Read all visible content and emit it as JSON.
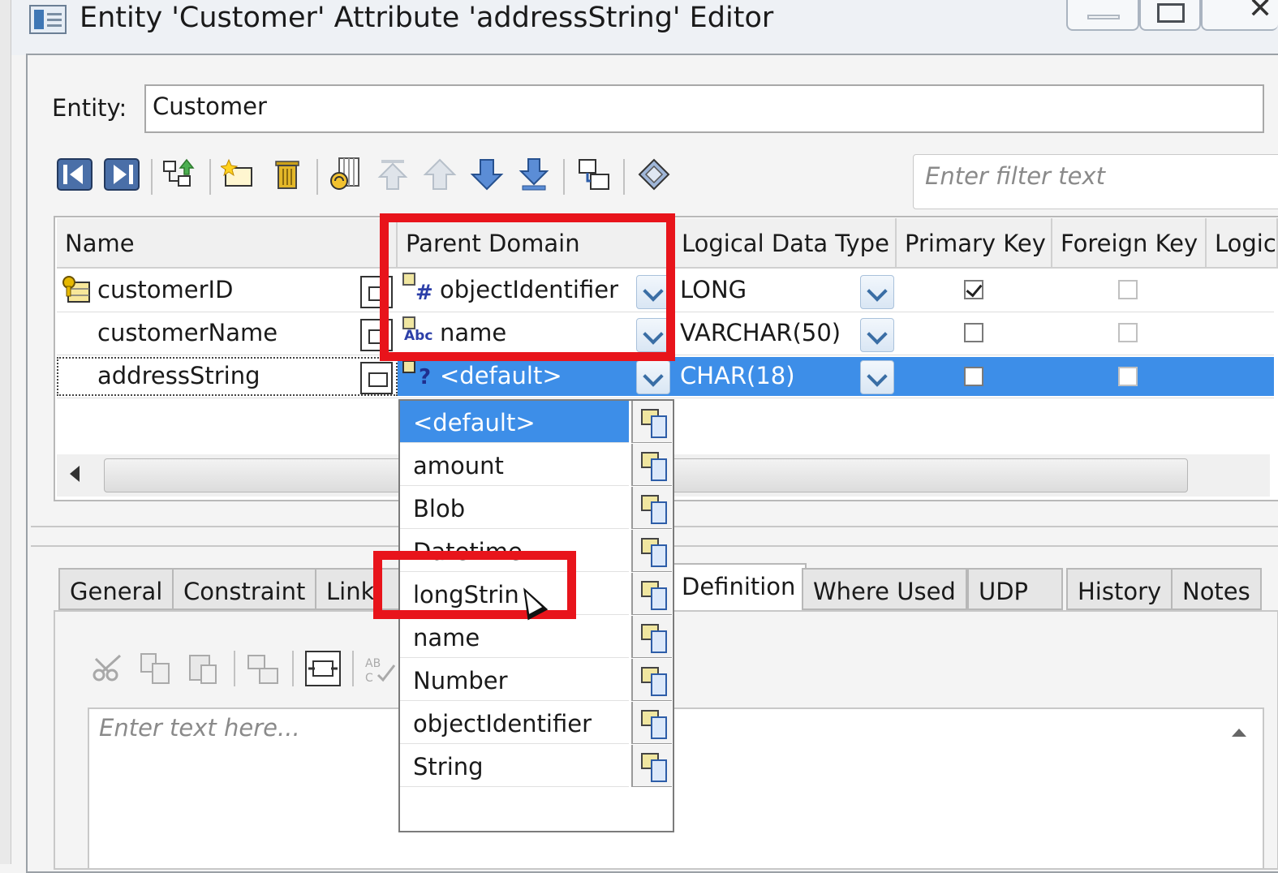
{
  "window": {
    "title": "Entity 'Customer' Attribute 'addressString' Editor"
  },
  "entity": {
    "label": "Entity:",
    "value": "Customer"
  },
  "filter": {
    "placeholder": "Enter filter text"
  },
  "grid": {
    "columns": [
      "Name",
      "Parent Domain",
      "Logical Data Type",
      "Primary Key",
      "Foreign Key",
      "Logic"
    ],
    "rows": [
      {
        "name": "customerID",
        "parent_domain": "objectIdentifier",
        "domain_glyph": "#",
        "data_type": "LONG",
        "primary_key": true,
        "foreign_key": false
      },
      {
        "name": "customerName",
        "parent_domain": "name",
        "domain_glyph": "Abc",
        "data_type": "VARCHAR(50)",
        "primary_key": false,
        "foreign_key": false
      },
      {
        "name": "addressString",
        "parent_domain": "<default>",
        "domain_glyph": "?",
        "data_type": "CHAR(18)",
        "primary_key": false,
        "foreign_key": false,
        "selected": true
      }
    ]
  },
  "domain_dropdown": {
    "items": [
      "<default>",
      "amount",
      "Blob",
      "Datetime",
      "longString",
      "name",
      "Number",
      "objectIdentifier",
      "String"
    ],
    "visible_labels": [
      "<default>",
      "amount",
      "Blob",
      "Datetime",
      "longStrin",
      "name",
      "Number",
      "objectIdentifier",
      "String"
    ],
    "selected_index": 0,
    "hovered_index": 4
  },
  "tabs": [
    {
      "label": "General"
    },
    {
      "label": "Constraint"
    },
    {
      "label": "Link"
    },
    {
      "label": "Definition",
      "active": true
    },
    {
      "label": "Where Used"
    },
    {
      "label": "UDP"
    },
    {
      "label": "History"
    },
    {
      "label": "Notes"
    }
  ],
  "definition": {
    "placeholder": "Enter text here..."
  },
  "colors": {
    "selection": "#3d8ee8",
    "highlight_box": "#e8141b"
  }
}
